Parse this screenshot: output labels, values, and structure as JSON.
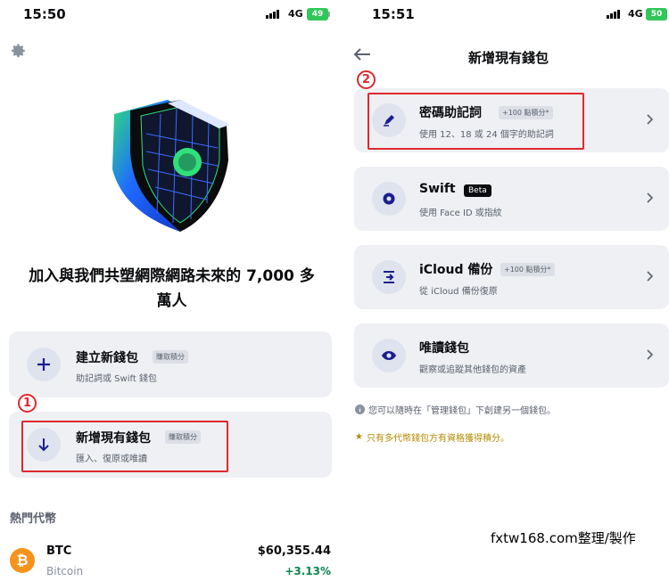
{
  "left_screen": {
    "status": {
      "time": "15:50",
      "network": "4G",
      "battery": "49"
    },
    "hero_title_line1": "加入與我們共塑網際網路未來的 7,000 多",
    "hero_title_line2": "萬人",
    "create_card": {
      "title": "建立新錢包",
      "badge": "賺取積分",
      "subtitle": "助記詞或 Swift 錢包"
    },
    "import_card": {
      "title": "新增現有錢包",
      "badge": "賺取積分",
      "subtitle": "匯入、復原或唯讀"
    },
    "annotation_1": "1",
    "popular_header": "熱門代幣",
    "coin": {
      "symbol": "BTC",
      "name": "Bitcoin",
      "price": "$60,355.44",
      "change": "+3.13%",
      "icon_letter": "₿"
    }
  },
  "right_screen": {
    "status": {
      "time": "15:51",
      "network": "4G",
      "battery": "50"
    },
    "page_title": "新增現有錢包",
    "annotation_2": "2",
    "options": [
      {
        "title": "密碼助記詞",
        "badge": "+100 點積分*",
        "subtitle": "使用 12、18 或 24 個字的助記詞",
        "icon": "pen-icon"
      },
      {
        "title": "Swift",
        "badge": "Beta",
        "subtitle": "使用 Face ID 或指紋",
        "icon": "gear-badge-icon"
      },
      {
        "title": "iCloud 備份",
        "badge": "+100 點積分*",
        "subtitle": "從 iCloud 備份復原",
        "icon": "restore-icon"
      },
      {
        "title": "唯讀錢包",
        "badge": "",
        "subtitle": "觀察或追蹤其他錢包的資產",
        "icon": "eye-icon"
      }
    ],
    "info_note": "您可以隨時在「管理錢包」下創建另一個錢包。",
    "star_note": "只有多代幣錢包方有資格獲得積分。",
    "watermark": "fxtw168.com整理/製作"
  },
  "colors": {
    "accent": "#0052ff",
    "annotation": "#e0282e",
    "positive": "#098551",
    "btc": "#f7931a"
  }
}
